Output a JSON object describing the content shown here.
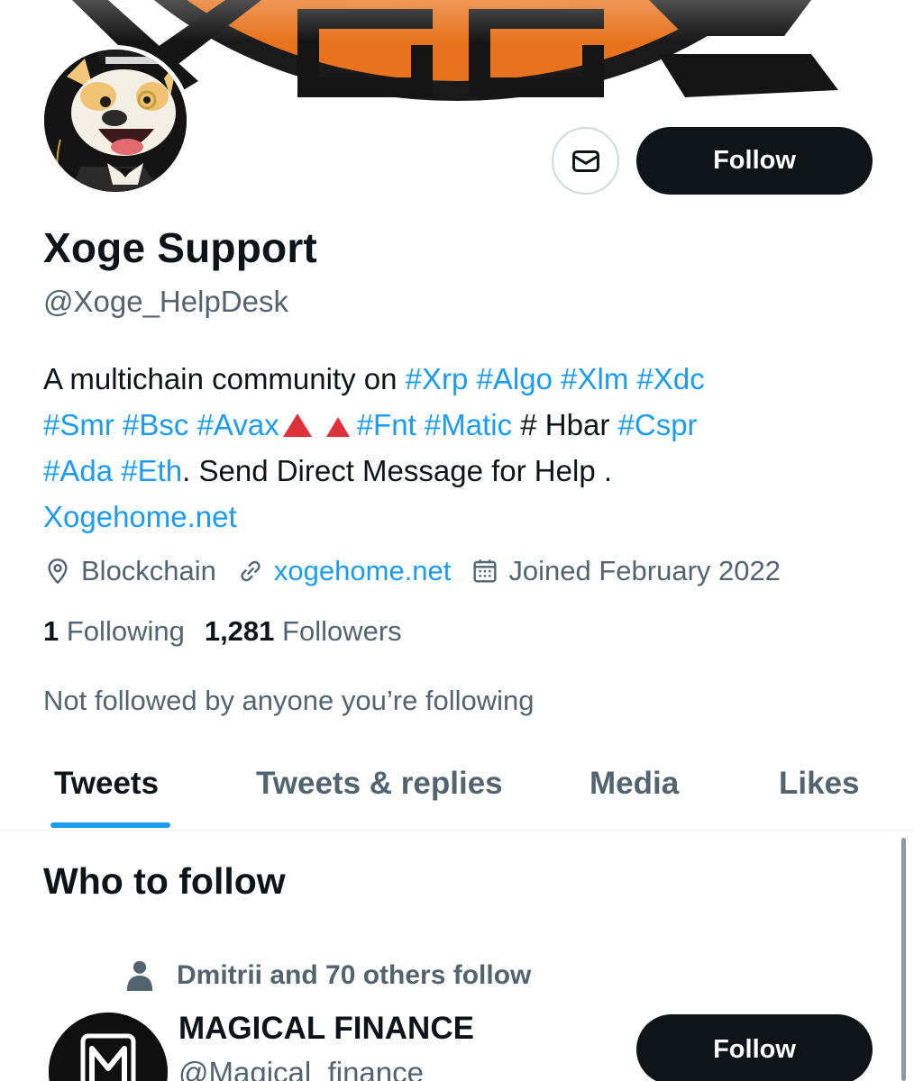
{
  "profile": {
    "name": "Xoge Support",
    "handle": "@Xoge_HelpDesk",
    "follow_label": "Follow",
    "bio": {
      "line1_text": "A multichain community on ",
      "line1_tags": [
        "#Xrp",
        "#Algo",
        "#Xlm",
        "#Xdc"
      ],
      "line2_tags_a": [
        "#Smr",
        "#Bsc",
        "#Avax"
      ],
      "line2_tags_b": [
        "#Fnt",
        "#Matic"
      ],
      "line2_plain": "# Hbar",
      "line2_tag_last": "#Cspr",
      "line3_tags": [
        "#Ada",
        "#Eth"
      ],
      "line3_text": ". Send Direct Message for Help .",
      "link": "Xogehome.net"
    },
    "location": "Blockchain",
    "website": "xogehome.net",
    "joined": "Joined February 2022",
    "following_count": "1",
    "following_label": "Following",
    "followers_count": "1,281",
    "followers_label": "Followers",
    "not_followed": "Not followed by anyone you’re following"
  },
  "tabs": [
    {
      "label": "Tweets",
      "active": true
    },
    {
      "label": "Tweets & replies",
      "active": false
    },
    {
      "label": "Media",
      "active": false
    },
    {
      "label": "Likes",
      "active": false
    }
  ],
  "who_to_follow": {
    "title": "Who to follow",
    "suggestion": {
      "social_context": "Dmitrii and 70 others follow",
      "name": "MAGICAL FINANCE",
      "handle": "@Magical_finance",
      "follow_label": "Follow"
    }
  },
  "icons": {
    "mail": "envelope-icon",
    "location": "location-pin-icon",
    "link": "link-icon",
    "calendar": "calendar-icon",
    "person": "person-icon",
    "warning": "red-triangle-icon"
  },
  "colors": {
    "accent": "#1d9bf0",
    "text": "#0f1419",
    "secondary": "#536471",
    "button_dark": "#0f1419",
    "banner_orange": "#f08a2a"
  }
}
